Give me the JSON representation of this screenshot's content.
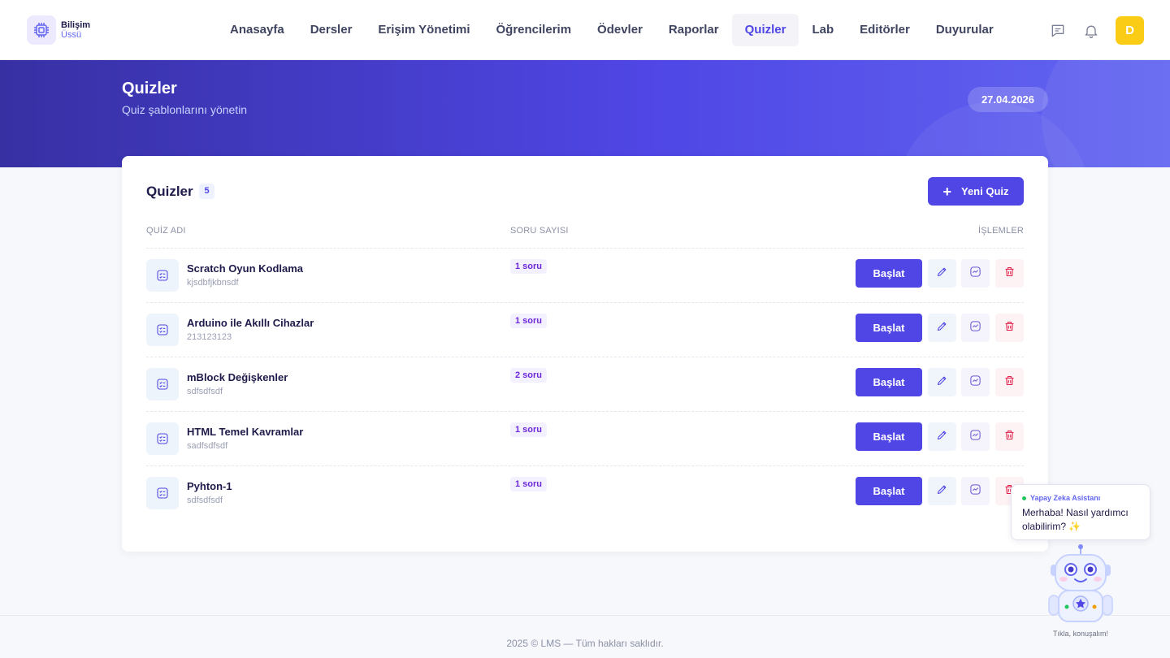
{
  "brand": {
    "line1": "Bilişim",
    "line2": "Üssü"
  },
  "nav": {
    "items": [
      {
        "label": "Anasayfa"
      },
      {
        "label": "Dersler"
      },
      {
        "label": "Erişim Yönetimi"
      },
      {
        "label": "Öğrencilerim"
      },
      {
        "label": "Ödevler"
      },
      {
        "label": "Raporlar"
      },
      {
        "label": "Quizler",
        "active": true
      },
      {
        "label": "Lab"
      },
      {
        "label": "Editörler"
      },
      {
        "label": "Duyurular"
      }
    ]
  },
  "user": {
    "initial": "D"
  },
  "hero": {
    "title": "Quizler",
    "subtitle": "Quiz şablonlarını yönetin",
    "date": "27.04.2026"
  },
  "card": {
    "title": "Quizler",
    "count": "5",
    "new_button": "Yeni Quiz",
    "columns": {
      "name": "QUİZ ADI",
      "questions": "SORU SAYISI",
      "actions": "İŞLEMLER"
    }
  },
  "quizzes": [
    {
      "name": "Scratch Oyun Kodlama",
      "desc": "kjsdbfjkbnsdf",
      "count": "1 soru",
      "start": "Başlat"
    },
    {
      "name": "Arduino ile Akıllı Cihazlar",
      "desc": "213123123",
      "count": "1 soru",
      "start": "Başlat"
    },
    {
      "name": "mBlock Değişkenler",
      "desc": "sdfsdfsdf",
      "count": "2 soru",
      "start": "Başlat"
    },
    {
      "name": "HTML Temel Kavramlar",
      "desc": "sadfsdfsdf",
      "count": "1 soru",
      "start": "Başlat"
    },
    {
      "name": "Pyhton-1",
      "desc": "sdfsdfsdf",
      "count": "1 soru",
      "start": "Başlat"
    }
  ],
  "footer": {
    "text": "2025 © LMS — Tüm hakları saklıdır."
  },
  "assistant": {
    "title": "Yapay Zeka Asistanı",
    "message": "Merhaba! Nasıl yardımcı olabilirim? ✨",
    "caption": "Tıkla, konuşalım!"
  },
  "colors": {
    "accent": "#4f46e5",
    "hero_start": "#3730a3",
    "hero_end": "#6366f1",
    "avatar": "#facc15",
    "danger": "#e11d48"
  }
}
